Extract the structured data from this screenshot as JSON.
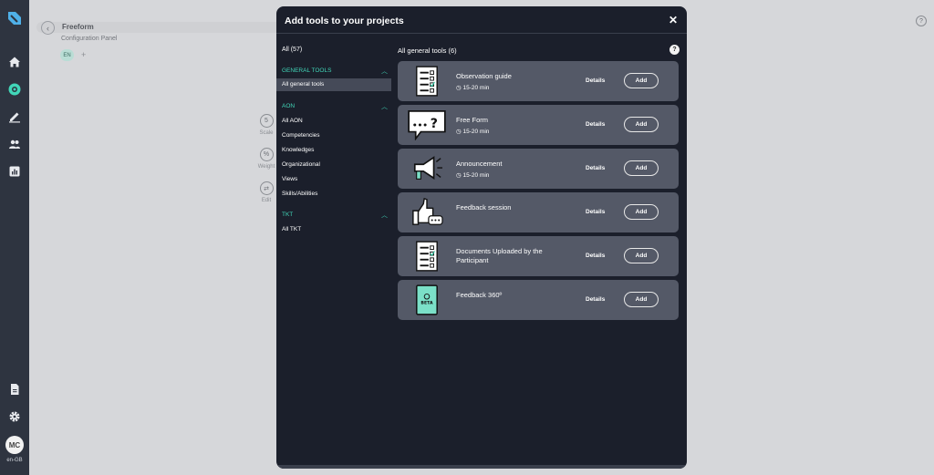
{
  "rail": {
    "avatar_initials": "MC",
    "locale": "en-GB"
  },
  "background_page": {
    "title": "Freeform",
    "subtitle": "Configuration Panel",
    "language_chip": "EN",
    "add_language": "+",
    "tools": [
      {
        "label": "Scale",
        "glyph": "5"
      },
      {
        "label": "Weight",
        "glyph": "%"
      },
      {
        "label": "Edit",
        "glyph": "⇄"
      }
    ],
    "help_glyph": "?"
  },
  "modal": {
    "title": "Add tools to your projects",
    "close_glyph": "✕",
    "sidebar": {
      "all_label": "All (57)",
      "groups": [
        {
          "heading": "GENERAL TOOLS",
          "items": [
            "All general tools"
          ]
        },
        {
          "heading": "AON",
          "items": [
            "All AON",
            "Competencies",
            "Knowledges",
            "Organizational",
            "Views",
            "Skills/Abilities"
          ]
        },
        {
          "heading": "TKT",
          "items": [
            "All TKT"
          ]
        }
      ],
      "active_item": "All general tools"
    },
    "content": {
      "heading": "All general tools (6)",
      "help_glyph": "?",
      "details_label": "Details",
      "add_label": "Add",
      "tools": [
        {
          "name": "Observation guide",
          "duration": "15-20 min",
          "icon": "checklist-icon"
        },
        {
          "name": "Free Form",
          "duration": "15-20 min",
          "icon": "speech-bubble-icon"
        },
        {
          "name": "Announcement",
          "duration": "15-20 min",
          "icon": "megaphone-icon"
        },
        {
          "name": "Feedback session",
          "duration": "",
          "icon": "thumbs-up-icon"
        },
        {
          "name": "Documents Uploaded by the Participant",
          "duration": "",
          "icon": "document-checklist-icon"
        },
        {
          "name": "Feedback 360º",
          "duration": "",
          "icon": "beta-tablet-icon"
        }
      ],
      "beta_label": "BETA"
    }
  },
  "colors": {
    "rail": "#2e3440",
    "modal": "#1b1f2b",
    "card": "#545967",
    "accent": "#41d6b8"
  }
}
